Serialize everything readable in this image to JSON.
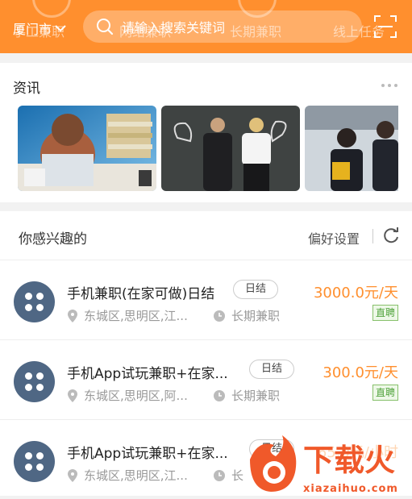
{
  "header": {
    "city": "厦门市",
    "search_placeholder": "请输入搜索关键词",
    "bg_tabs": [
      "手工兼职",
      "网络兼职",
      "长期兼职",
      "线上任务"
    ]
  },
  "news": {
    "title": "资讯",
    "images": [
      "stressed-office-worker",
      "businesspeople-chalk-muscles",
      "business-meeting"
    ]
  },
  "interest": {
    "title": "你感兴趣的",
    "preference_label": "偏好设置",
    "jobs": [
      {
        "title": "手机兼职(在家可做)日结",
        "tag": "日结",
        "location": "东城区,思明区,江...",
        "term": "长期兼职",
        "salary": "3000.0元/天",
        "badge": "直聘"
      },
      {
        "title": "手机App试玩兼职+在家...",
        "tag": "日结",
        "location": "东城区,思明区,阿...",
        "term": "长期兼职",
        "salary": "300.0元/天",
        "badge": "直聘"
      },
      {
        "title": "手机App试玩兼职+在家...",
        "tag": "日结",
        "location": "东城区,思明区,江...",
        "term": "长",
        "salary": "65.0元/小时",
        "badge": ""
      }
    ]
  },
  "watermark": {
    "text": "下载火",
    "url": "xiazaihuo.com"
  },
  "colors": {
    "accent": "#ff8f2e",
    "avatar": "#4f6784",
    "badge_green": "#4fa23a"
  }
}
